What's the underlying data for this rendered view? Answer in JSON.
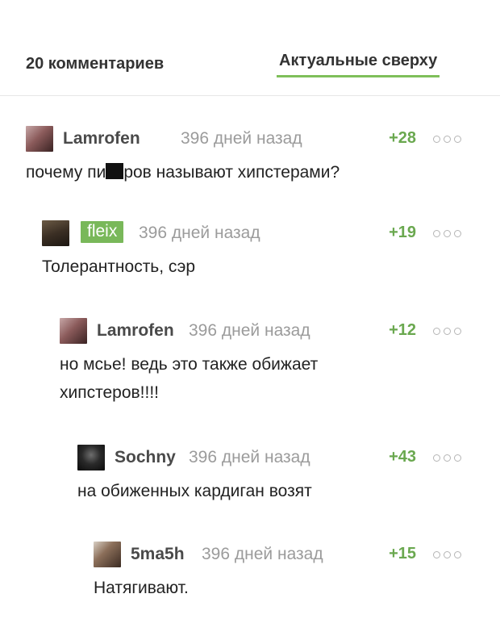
{
  "header": {
    "comments_count": "20 комментариев",
    "sort_label": "Актуальные сверху"
  },
  "comments": [
    {
      "author": "Lamrofen",
      "time": "396 дней назад",
      "rating": "+28",
      "text_before": "почему пи",
      "text_after": "ров называют хипстерами?"
    },
    {
      "author": "fleix",
      "time": "396 дней назад",
      "rating": "+19",
      "text": "Толерантность, сэр"
    },
    {
      "author": "Lamrofen",
      "time": "396 дней назад",
      "rating": "+12",
      "text": "но мсье! ведь это также обижает хипстеров!!!!"
    },
    {
      "author": "Sochny",
      "time": "396 дней назад",
      "rating": "+43",
      "text": "на обиженных кардиган возят"
    },
    {
      "author": "5ma5h",
      "time": "396 дней назад",
      "rating": "+15",
      "text": "Натягивают."
    }
  ],
  "colors": {
    "accent": "#79b85a",
    "rating": "#6aa84f"
  }
}
